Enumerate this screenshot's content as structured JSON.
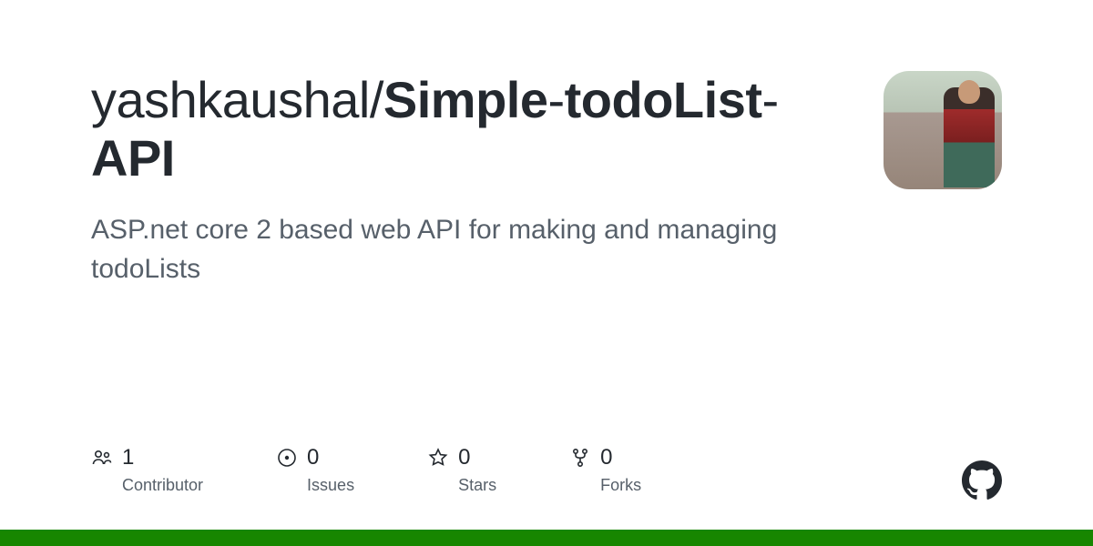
{
  "repo": {
    "owner": "yashkaushal",
    "name_parts": [
      "Simple",
      "todoList",
      "API"
    ],
    "description": "ASP.net core 2 based web API for making and managing todoLists"
  },
  "stats": {
    "contributors": {
      "count": "1",
      "label": "Contributor"
    },
    "issues": {
      "count": "0",
      "label": "Issues"
    },
    "stars": {
      "count": "0",
      "label": "Stars"
    },
    "forks": {
      "count": "0",
      "label": "Forks"
    }
  },
  "language_color": "#178600"
}
